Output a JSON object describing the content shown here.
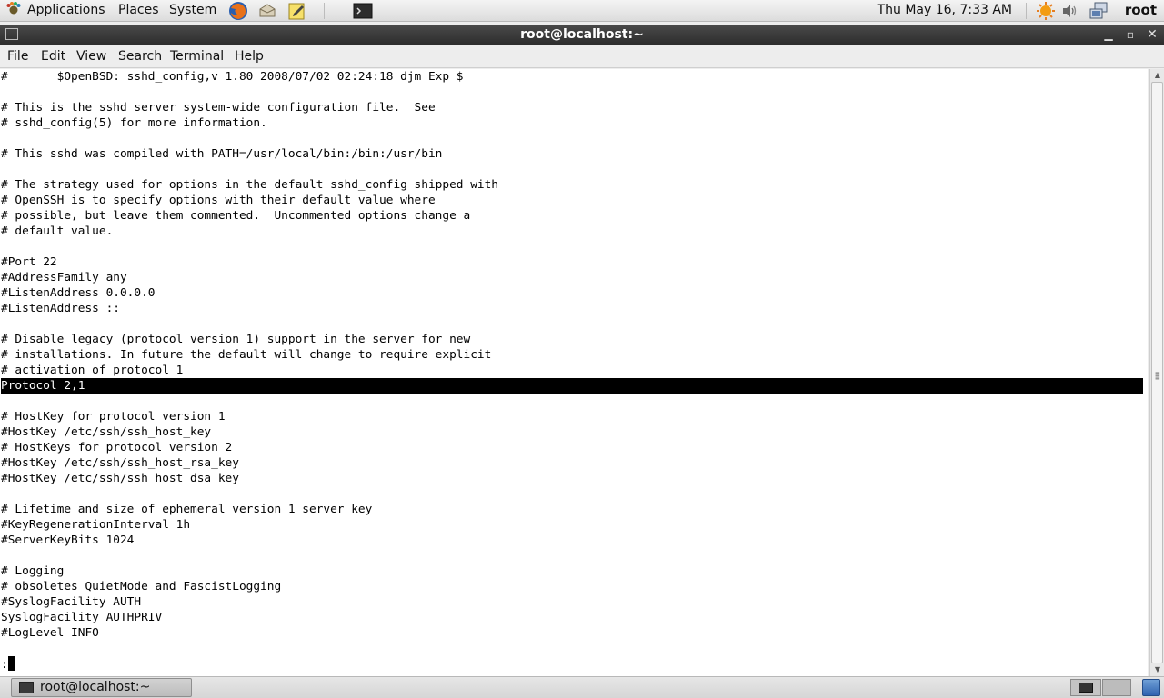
{
  "top_panel": {
    "applications": "Applications",
    "places": "Places",
    "system": "System",
    "clock": "Thu May 16,  7:33 AM",
    "user": "root"
  },
  "window": {
    "title": "root@localhost:~"
  },
  "menubar": {
    "file": "File",
    "edit": "Edit",
    "view": "View",
    "search": "Search",
    "terminal": "Terminal",
    "help": "Help"
  },
  "terminal": {
    "lines": [
      "#\t$OpenBSD: sshd_config,v 1.80 2008/07/02 02:24:18 djm Exp $",
      "",
      "# This is the sshd server system-wide configuration file.  See",
      "# sshd_config(5) for more information.",
      "",
      "# This sshd was compiled with PATH=/usr/local/bin:/bin:/usr/bin",
      "",
      "# The strategy used for options in the default sshd_config shipped with",
      "# OpenSSH is to specify options with their default value where",
      "# possible, but leave them commented.  Uncommented options change a",
      "# default value.",
      "",
      "#Port 22",
      "#AddressFamily any",
      "#ListenAddress 0.0.0.0",
      "#ListenAddress ::",
      "",
      "# Disable legacy (protocol version 1) support in the server for new",
      "# installations. In future the default will change to require explicit",
      "# activation of protocol 1",
      "Protocol 2,1",
      "",
      "# HostKey for protocol version 1",
      "#HostKey /etc/ssh/ssh_host_key",
      "# HostKeys for protocol version 2",
      "#HostKey /etc/ssh/ssh_host_rsa_key",
      "#HostKey /etc/ssh/ssh_host_dsa_key",
      "",
      "# Lifetime and size of ephemeral version 1 server key",
      "#KeyRegenerationInterval 1h",
      "#ServerKeyBits 1024",
      "",
      "# Logging",
      "# obsoletes QuietMode and FascistLogging",
      "#SyslogFacility AUTH",
      "SyslogFacility AUTHPRIV",
      "#LogLevel INFO"
    ],
    "highlighted_line": 20,
    "prompt": ":"
  },
  "taskbar": {
    "task_label": "root@localhost:~"
  }
}
